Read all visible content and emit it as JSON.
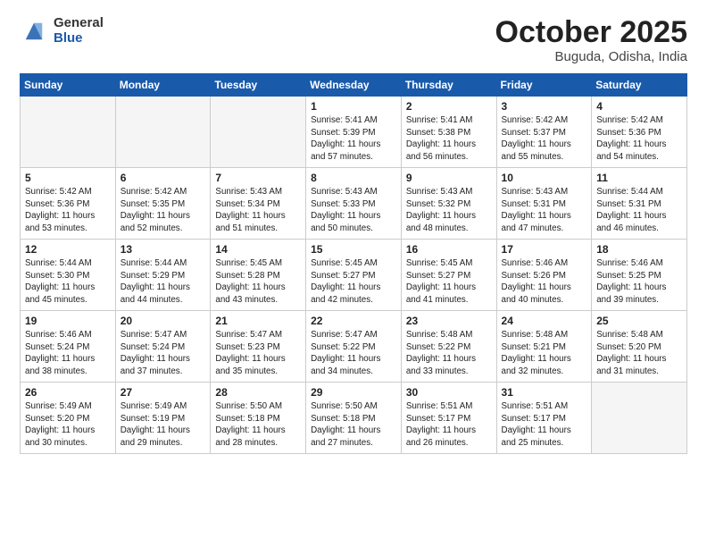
{
  "logo": {
    "general": "General",
    "blue": "Blue"
  },
  "title": "October 2025",
  "subtitle": "Buguda, Odisha, India",
  "days_of_week": [
    "Sunday",
    "Monday",
    "Tuesday",
    "Wednesday",
    "Thursday",
    "Friday",
    "Saturday"
  ],
  "weeks": [
    [
      {
        "day": "",
        "info": ""
      },
      {
        "day": "",
        "info": ""
      },
      {
        "day": "",
        "info": ""
      },
      {
        "day": "1",
        "info": "Sunrise: 5:41 AM\nSunset: 5:39 PM\nDaylight: 11 hours\nand 57 minutes."
      },
      {
        "day": "2",
        "info": "Sunrise: 5:41 AM\nSunset: 5:38 PM\nDaylight: 11 hours\nand 56 minutes."
      },
      {
        "day": "3",
        "info": "Sunrise: 5:42 AM\nSunset: 5:37 PM\nDaylight: 11 hours\nand 55 minutes."
      },
      {
        "day": "4",
        "info": "Sunrise: 5:42 AM\nSunset: 5:36 PM\nDaylight: 11 hours\nand 54 minutes."
      }
    ],
    [
      {
        "day": "5",
        "info": "Sunrise: 5:42 AM\nSunset: 5:36 PM\nDaylight: 11 hours\nand 53 minutes."
      },
      {
        "day": "6",
        "info": "Sunrise: 5:42 AM\nSunset: 5:35 PM\nDaylight: 11 hours\nand 52 minutes."
      },
      {
        "day": "7",
        "info": "Sunrise: 5:43 AM\nSunset: 5:34 PM\nDaylight: 11 hours\nand 51 minutes."
      },
      {
        "day": "8",
        "info": "Sunrise: 5:43 AM\nSunset: 5:33 PM\nDaylight: 11 hours\nand 50 minutes."
      },
      {
        "day": "9",
        "info": "Sunrise: 5:43 AM\nSunset: 5:32 PM\nDaylight: 11 hours\nand 48 minutes."
      },
      {
        "day": "10",
        "info": "Sunrise: 5:43 AM\nSunset: 5:31 PM\nDaylight: 11 hours\nand 47 minutes."
      },
      {
        "day": "11",
        "info": "Sunrise: 5:44 AM\nSunset: 5:31 PM\nDaylight: 11 hours\nand 46 minutes."
      }
    ],
    [
      {
        "day": "12",
        "info": "Sunrise: 5:44 AM\nSunset: 5:30 PM\nDaylight: 11 hours\nand 45 minutes."
      },
      {
        "day": "13",
        "info": "Sunrise: 5:44 AM\nSunset: 5:29 PM\nDaylight: 11 hours\nand 44 minutes."
      },
      {
        "day": "14",
        "info": "Sunrise: 5:45 AM\nSunset: 5:28 PM\nDaylight: 11 hours\nand 43 minutes."
      },
      {
        "day": "15",
        "info": "Sunrise: 5:45 AM\nSunset: 5:27 PM\nDaylight: 11 hours\nand 42 minutes."
      },
      {
        "day": "16",
        "info": "Sunrise: 5:45 AM\nSunset: 5:27 PM\nDaylight: 11 hours\nand 41 minutes."
      },
      {
        "day": "17",
        "info": "Sunrise: 5:46 AM\nSunset: 5:26 PM\nDaylight: 11 hours\nand 40 minutes."
      },
      {
        "day": "18",
        "info": "Sunrise: 5:46 AM\nSunset: 5:25 PM\nDaylight: 11 hours\nand 39 minutes."
      }
    ],
    [
      {
        "day": "19",
        "info": "Sunrise: 5:46 AM\nSunset: 5:24 PM\nDaylight: 11 hours\nand 38 minutes."
      },
      {
        "day": "20",
        "info": "Sunrise: 5:47 AM\nSunset: 5:24 PM\nDaylight: 11 hours\nand 37 minutes."
      },
      {
        "day": "21",
        "info": "Sunrise: 5:47 AM\nSunset: 5:23 PM\nDaylight: 11 hours\nand 35 minutes."
      },
      {
        "day": "22",
        "info": "Sunrise: 5:47 AM\nSunset: 5:22 PM\nDaylight: 11 hours\nand 34 minutes."
      },
      {
        "day": "23",
        "info": "Sunrise: 5:48 AM\nSunset: 5:22 PM\nDaylight: 11 hours\nand 33 minutes."
      },
      {
        "day": "24",
        "info": "Sunrise: 5:48 AM\nSunset: 5:21 PM\nDaylight: 11 hours\nand 32 minutes."
      },
      {
        "day": "25",
        "info": "Sunrise: 5:48 AM\nSunset: 5:20 PM\nDaylight: 11 hours\nand 31 minutes."
      }
    ],
    [
      {
        "day": "26",
        "info": "Sunrise: 5:49 AM\nSunset: 5:20 PM\nDaylight: 11 hours\nand 30 minutes."
      },
      {
        "day": "27",
        "info": "Sunrise: 5:49 AM\nSunset: 5:19 PM\nDaylight: 11 hours\nand 29 minutes."
      },
      {
        "day": "28",
        "info": "Sunrise: 5:50 AM\nSunset: 5:18 PM\nDaylight: 11 hours\nand 28 minutes."
      },
      {
        "day": "29",
        "info": "Sunrise: 5:50 AM\nSunset: 5:18 PM\nDaylight: 11 hours\nand 27 minutes."
      },
      {
        "day": "30",
        "info": "Sunrise: 5:51 AM\nSunset: 5:17 PM\nDaylight: 11 hours\nand 26 minutes."
      },
      {
        "day": "31",
        "info": "Sunrise: 5:51 AM\nSunset: 5:17 PM\nDaylight: 11 hours\nand 25 minutes."
      },
      {
        "day": "",
        "info": ""
      }
    ]
  ]
}
